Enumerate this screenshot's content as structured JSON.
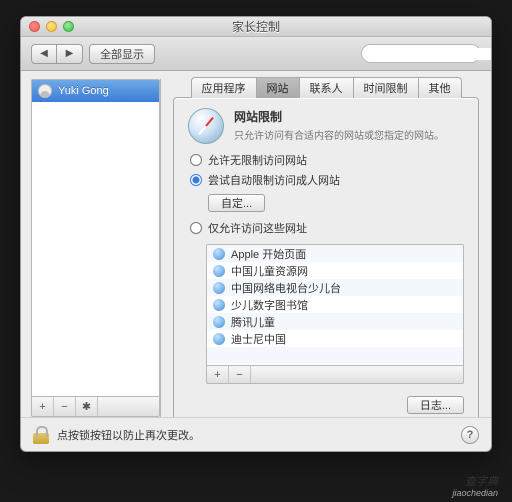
{
  "window": {
    "title": "家长控制"
  },
  "toolbar": {
    "back_icon": "◀",
    "fwd_icon": "▶",
    "show_all": "全部显示",
    "search_placeholder": ""
  },
  "sidebar": {
    "users": [
      {
        "name": "Yuki Gong",
        "selected": true
      }
    ],
    "add": "+",
    "remove": "−",
    "gear": "✱"
  },
  "tabs": [
    {
      "label": "应用程序",
      "selected": false
    },
    {
      "label": "网站",
      "selected": true
    },
    {
      "label": "联系人",
      "selected": false
    },
    {
      "label": "时间限制",
      "selected": false
    },
    {
      "label": "其他",
      "selected": false
    }
  ],
  "panel": {
    "heading": "网站限制",
    "subheading": "只允许访问有合适内容的网站或您指定的网站。",
    "options": [
      {
        "label": "允许无限制访问网站",
        "checked": false
      },
      {
        "label": "尝试自动限制访问成人网站",
        "checked": true,
        "customize": "自定..."
      },
      {
        "label": "仅允许访问这些网址",
        "checked": false
      }
    ],
    "whitelist": [
      "Apple 开始页面",
      "中国儿童资源网",
      "中国网络电视台少儿台",
      "少儿数字图书馆",
      "腾讯儿童",
      "迪士尼中国"
    ],
    "wl_add": "+",
    "wl_remove": "−",
    "logs_btn": "日志..."
  },
  "footer": {
    "lock_text": "点按锁按钮以防止再次更改。",
    "help": "?"
  },
  "watermark": {
    "big": "查字典",
    "small": "jiaochedian"
  }
}
